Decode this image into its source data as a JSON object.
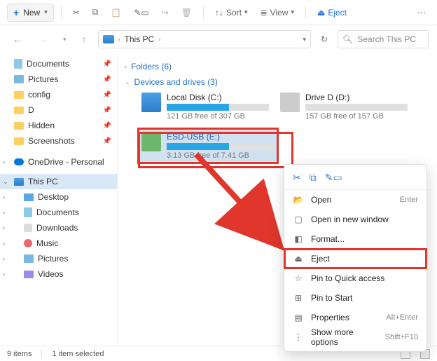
{
  "toolbar": {
    "new_label": "New",
    "sort_label": "Sort",
    "view_label": "View",
    "eject_label": "Eject"
  },
  "nav": {
    "breadcrumb": "This PC",
    "search_placeholder": "Search This PC"
  },
  "sidebar": {
    "items": [
      {
        "label": "Documents",
        "icon": "doc",
        "pinned": true
      },
      {
        "label": "Pictures",
        "icon": "pic",
        "pinned": true
      },
      {
        "label": "config",
        "icon": "folder",
        "pinned": true
      },
      {
        "label": "D",
        "icon": "folder",
        "pinned": true
      },
      {
        "label": "Hidden",
        "icon": "folder",
        "pinned": true
      },
      {
        "label": "Screenshots",
        "icon": "folder",
        "pinned": true
      }
    ],
    "onedrive": "OneDrive - Personal",
    "thispc": "This PC",
    "pc_children": [
      {
        "label": "Desktop",
        "icon": "desk"
      },
      {
        "label": "Documents",
        "icon": "doc"
      },
      {
        "label": "Downloads",
        "icon": "dl"
      },
      {
        "label": "Music",
        "icon": "music"
      },
      {
        "label": "Pictures",
        "icon": "pic"
      },
      {
        "label": "Videos",
        "icon": "video"
      }
    ]
  },
  "content": {
    "folders_header": "Folders (6)",
    "devices_header": "Devices and drives (3)",
    "drives": [
      {
        "name": "Local Disk (C:)",
        "free": "121 GB free of 307 GB",
        "fill_pct": 61,
        "icon": "win"
      },
      {
        "name": "Drive D (D:)",
        "free": "157 GB free of 157 GB",
        "fill_pct": 0,
        "icon": "hdd"
      },
      {
        "name": "ESD-USB (E:)",
        "free": "3.13 GB free of 7.41 GB",
        "fill_pct": 58,
        "icon": "usb",
        "selected": true
      }
    ]
  },
  "context_menu": {
    "items": [
      {
        "label": "Open",
        "shortcut": "Enter",
        "icon": "📂"
      },
      {
        "label": "Open in new window",
        "shortcut": "",
        "icon": "▢"
      },
      {
        "label": "Format...",
        "shortcut": "",
        "icon": "◧"
      },
      {
        "label": "Eject",
        "shortcut": "",
        "icon": "⏏",
        "highlight": true
      },
      {
        "label": "Pin to Quick access",
        "shortcut": "",
        "icon": "☆"
      },
      {
        "label": "Pin to Start",
        "shortcut": "",
        "icon": "⊞"
      },
      {
        "label": "Properties",
        "shortcut": "Alt+Enter",
        "icon": "▤"
      },
      {
        "label": "Show more options",
        "shortcut": "Shift+F10",
        "icon": "⋮"
      }
    ]
  },
  "status": {
    "count": "9 items",
    "selected": "1 item selected"
  },
  "highlight_color": "#e0362c"
}
